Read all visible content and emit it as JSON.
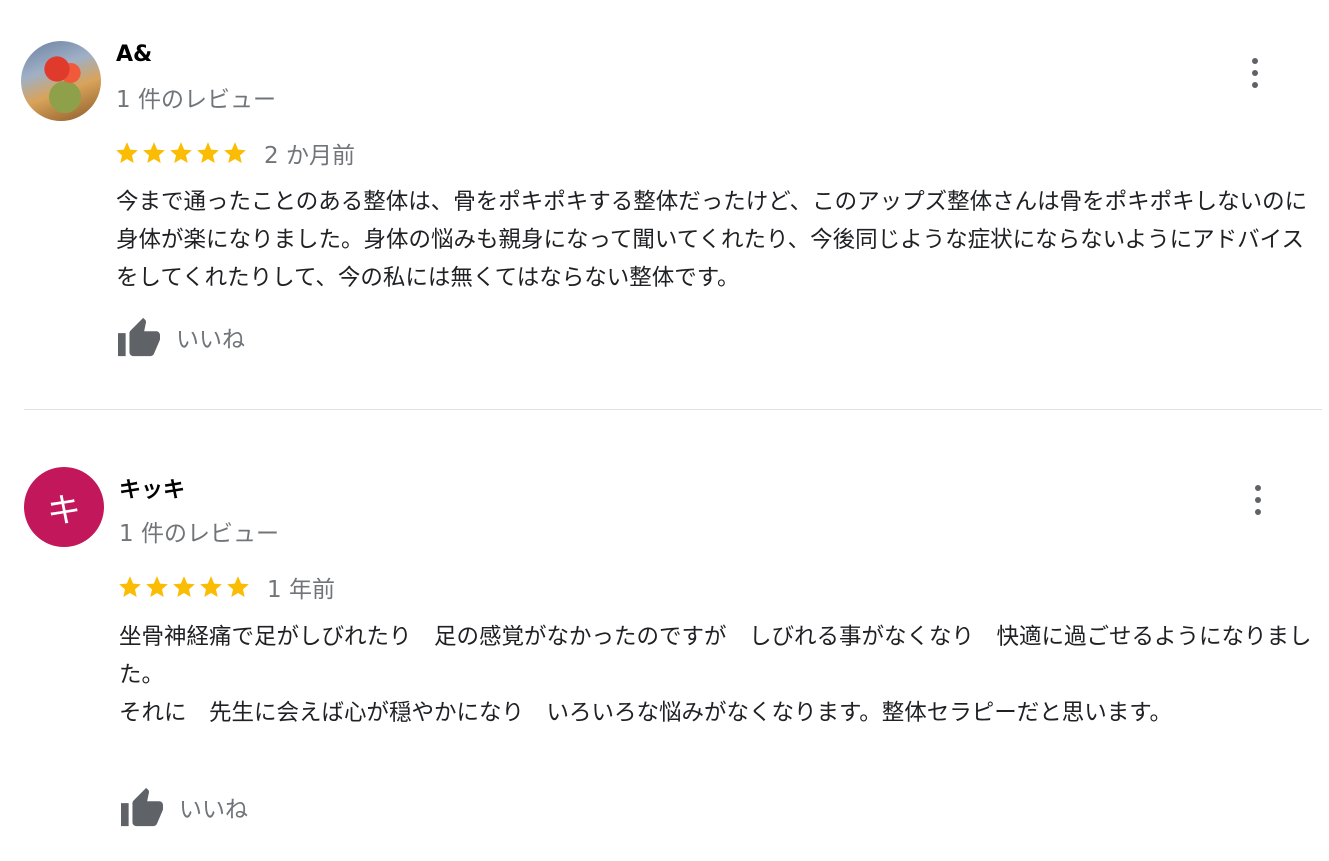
{
  "reviews": [
    {
      "name": "A&",
      "review_count": "1 件のレビュー",
      "rating": 5,
      "date": "2 か月前",
      "text": "今まで通ったことのある整体は、骨をポキポキする整体だったけど、このアップズ整体さんは骨をポキポキしないのに身体が楽になりました。身体の悩みも親身になって聞いてくれたり、今後同じような症状にならないようにアドバイスをしてくれたりして、今の私には無くてはならない整体です。",
      "like_label": "いいね",
      "avatar_type": "photo"
    },
    {
      "name": "キッキ",
      "avatar_letter": "キ",
      "review_count": "1 件のレビュー",
      "rating": 5,
      "date": "1 年前",
      "text": "坐骨神経痛で足がしびれたり　足の感覚がなかったのですが　しびれる事がなくなり　快適に過ごせるようになりました。\nそれに　先生に会えば心が穏やかになり　いろいろな悩みがなくなります。整体セラピーだと思います。",
      "like_label": "いいね",
      "avatar_type": "letter"
    }
  ],
  "colors": {
    "star": "#fbbc04",
    "avatar_letter_bg": "#c2185b",
    "secondary_text": "#70757a",
    "icon": "#5f6368"
  },
  "icons": {
    "more": "more-vert-icon",
    "like": "thumb-up-icon",
    "star": "star-icon"
  }
}
